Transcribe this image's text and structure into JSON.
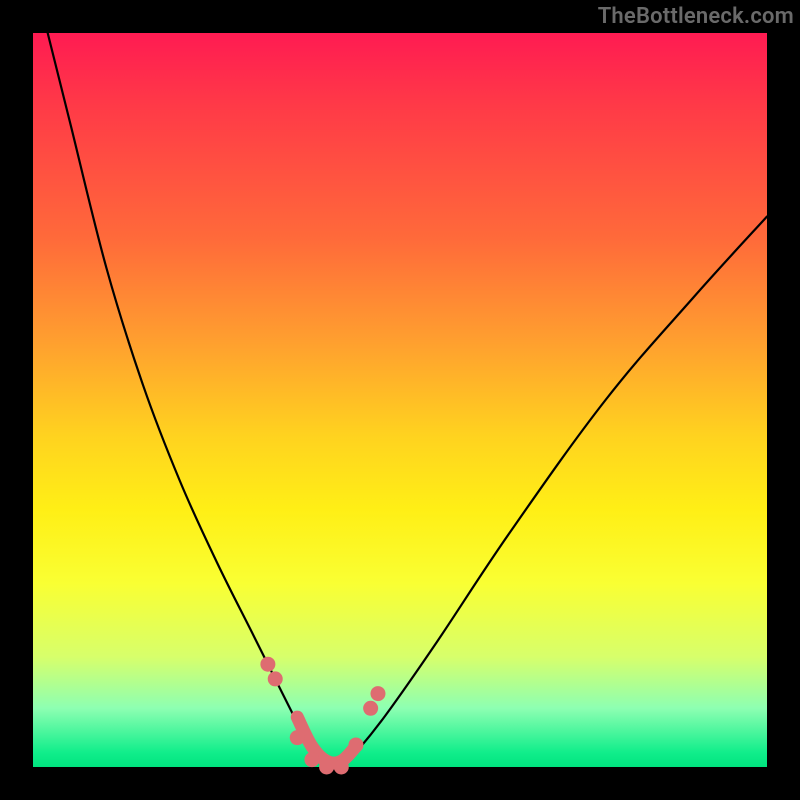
{
  "watermark": "TheBottleneck.com",
  "colors": {
    "frame": "#000000",
    "curve": "#000000",
    "marker": "#de6c71",
    "gradient_top": "#ff1b52",
    "gradient_bottom": "#00e47f"
  },
  "chart_data": {
    "type": "line",
    "title": "",
    "xlabel": "",
    "ylabel": "",
    "xlim": [
      0,
      100
    ],
    "ylim": [
      0,
      100
    ],
    "series": [
      {
        "name": "bottleneck-curve",
        "x": [
          2,
          5,
          10,
          15,
          20,
          25,
          30,
          34,
          36,
          38,
          40,
          42,
          44,
          48,
          55,
          65,
          78,
          90,
          100
        ],
        "y": [
          100,
          88,
          68,
          52,
          39,
          28,
          18,
          10,
          6,
          2,
          0,
          0,
          2,
          7,
          17,
          32,
          50,
          64,
          75
        ]
      }
    ],
    "markers": {
      "name": "highlighted-points",
      "x": [
        32,
        33,
        36,
        38,
        40,
        42,
        44,
        46,
        47
      ],
      "y": [
        14,
        12,
        4,
        1,
        0,
        0,
        3,
        8,
        10
      ]
    },
    "annotations": [],
    "background_gradient": "vertical rainbow red→yellow→green"
  }
}
